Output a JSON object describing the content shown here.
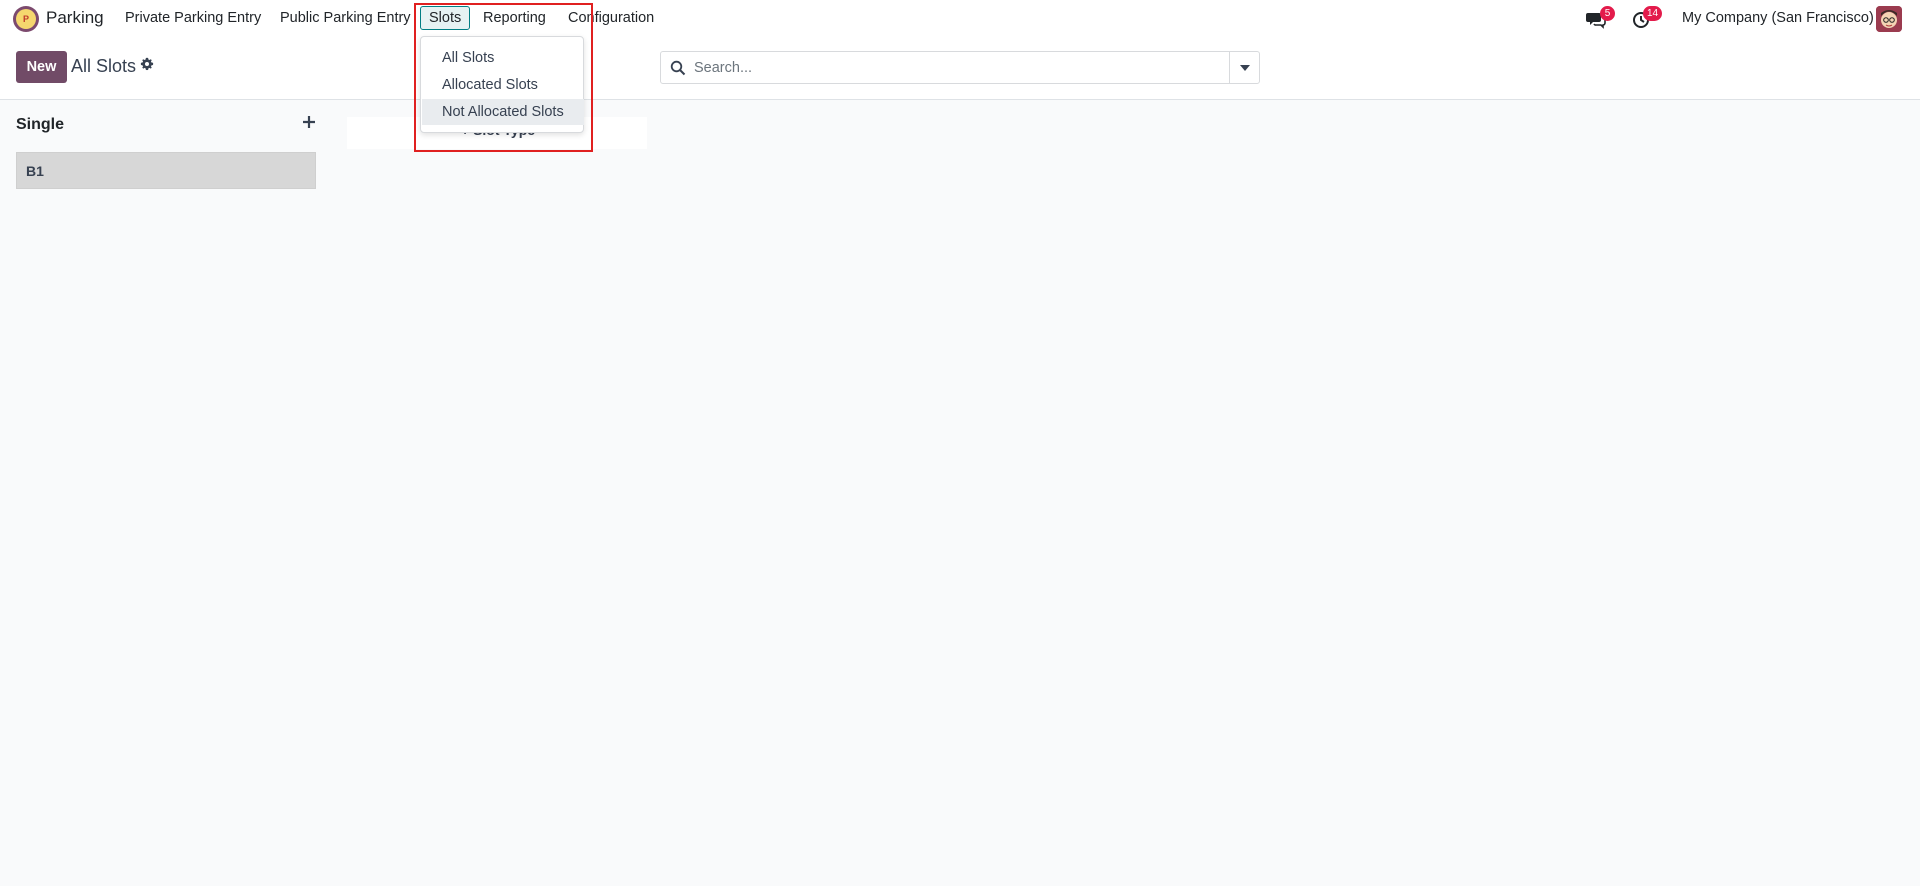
{
  "app": {
    "name": "Parking",
    "logo_icon": "parking-app-logo"
  },
  "nav": {
    "items": [
      {
        "label": "Private Parking Entry"
      },
      {
        "label": "Public Parking Entry"
      },
      {
        "label": "Slots"
      },
      {
        "label": "Reporting"
      },
      {
        "label": "Configuration"
      }
    ]
  },
  "slots_menu": {
    "items": [
      {
        "label": "All Slots"
      },
      {
        "label": "Allocated Slots"
      },
      {
        "label": "Not Allocated Slots"
      }
    ]
  },
  "systray": {
    "messages_count": "5",
    "activities_count": "14",
    "company": "My Company (San Francisco)"
  },
  "control_panel": {
    "new_label": "New",
    "breadcrumb": "All Slots",
    "search_placeholder": "Search..."
  },
  "kanban": {
    "column_title": "Single",
    "cards": [
      {
        "title": "B1"
      }
    ],
    "quick_group_label": "+ Slot Type"
  },
  "colors": {
    "primary": "#714b67",
    "accent": "#017e84",
    "badge": "#e31b4b",
    "highlight": "#e02020"
  }
}
